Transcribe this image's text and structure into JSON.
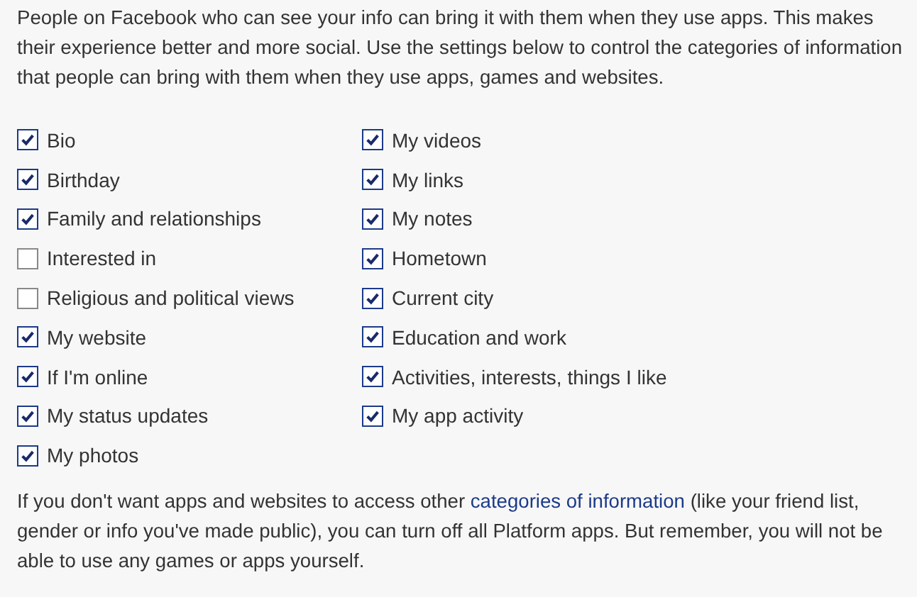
{
  "intro": "People on Facebook who can see your info can bring it with them when they use apps. This makes their experience better and more social. Use the settings below to control the categories of information that people can bring with them when they use apps, games and websites.",
  "left_column": [
    {
      "label": "Bio",
      "checked": true
    },
    {
      "label": "Birthday",
      "checked": true
    },
    {
      "label": "Family and relationships",
      "checked": true
    },
    {
      "label": "Interested in",
      "checked": false
    },
    {
      "label": "Religious and political views",
      "checked": false
    },
    {
      "label": "My website",
      "checked": true
    },
    {
      "label": "If I'm online",
      "checked": true
    },
    {
      "label": "My status updates",
      "checked": true
    },
    {
      "label": "My photos",
      "checked": true
    }
  ],
  "right_column": [
    {
      "label": "My videos",
      "checked": true
    },
    {
      "label": "My links",
      "checked": true
    },
    {
      "label": "My notes",
      "checked": true
    },
    {
      "label": "Hometown",
      "checked": true
    },
    {
      "label": "Current city",
      "checked": true
    },
    {
      "label": "Education and work",
      "checked": true
    },
    {
      "label": "Activities, interests, things I like",
      "checked": true
    },
    {
      "label": "My app activity",
      "checked": true
    }
  ],
  "footer": {
    "before": "If you don't want apps and websites to access other",
    "link": "categories of information",
    "after": "(like your friend list, gender or info you've made public), you can turn off all Platform apps. But remember, you will not be able to use any games or apps yourself."
  }
}
